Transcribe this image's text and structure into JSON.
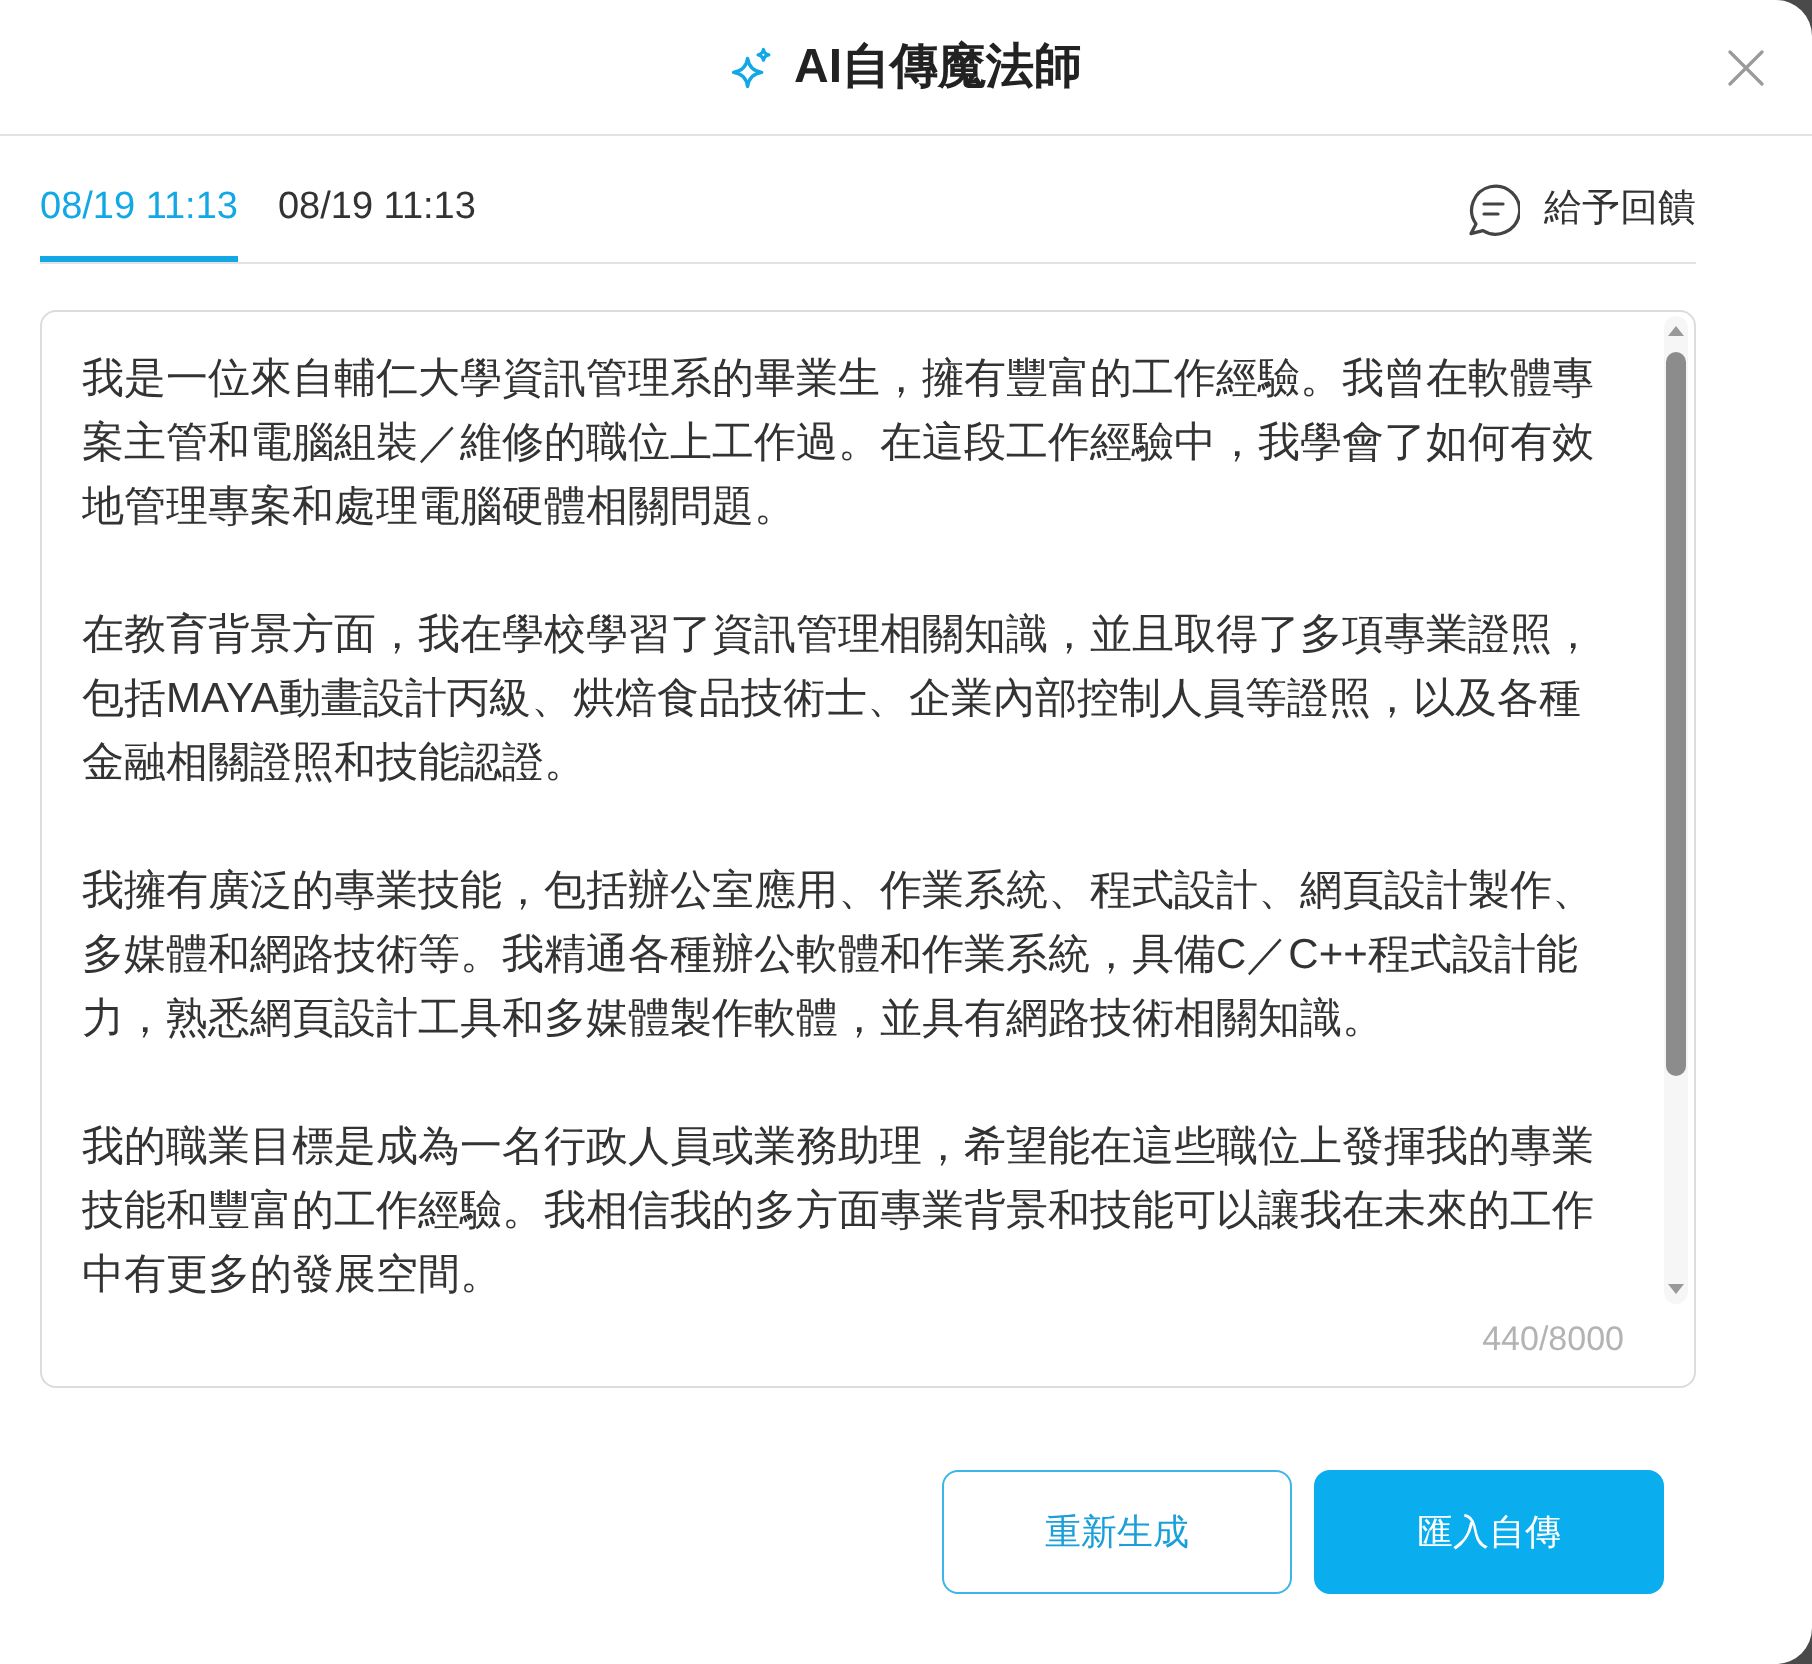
{
  "dialog": {
    "title": "AI自傳魔法師"
  },
  "tabs": [
    {
      "label": "08/19 11:13",
      "selected": true
    },
    {
      "label": "08/19 11:13",
      "selected": false
    }
  ],
  "feedback": {
    "label": "給予回饋"
  },
  "editor": {
    "paragraphs": [
      "我是一位來自輔仁大學資訊管理系的畢業生，擁有豐富的工作經驗。我曾在軟體專案主管和電腦組裝／維修的職位上工作過。在這段工作經驗中，我學會了如何有效地管理專案和處理電腦硬體相關問題。",
      "在教育背景方面，我在學校學習了資訊管理相關知識，並且取得了多項專業證照，包括MAYA動畫設計丙級、烘焙食品技術士、企業內部控制人員等證照，以及各種金融相關證照和技能認證。",
      "我擁有廣泛的專業技能，包括辦公室應用、作業系統、程式設計、網頁設計製作、多媒體和網路技術等。我精通各種辦公軟體和作業系統，具備C／C++程式設計能力，熟悉網頁設計工具和多媒體製作軟體，並具有網路技術相關知識。",
      "我的職業目標是成為一名行政人員或業務助理，希望能在這些職位上發揮我的專業技能和豐富的工作經驗。我相信我的多方面專業背景和技能可以讓我在未來的工作中有更多的發展空間。"
    ],
    "counter": "440/8000"
  },
  "buttons": [
    {
      "label": "重新生成",
      "kind": "outline"
    },
    {
      "label": "匯入自傳",
      "kind": "filled"
    }
  ]
}
